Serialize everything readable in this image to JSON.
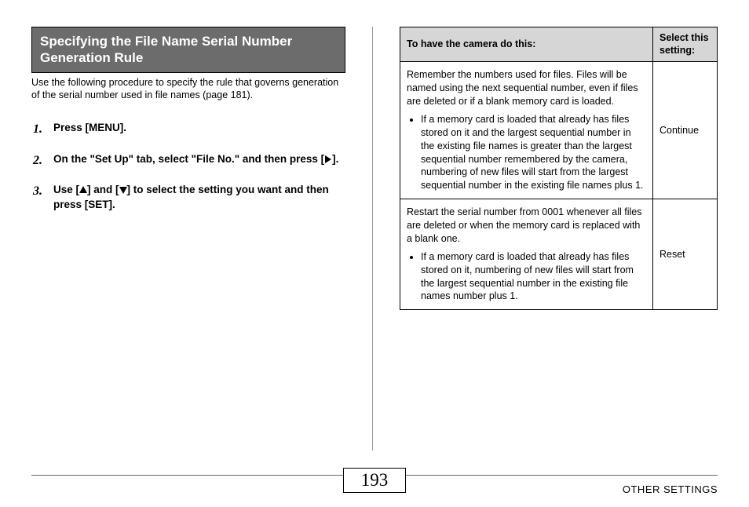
{
  "header": {
    "title": "Specifying the File Name Serial Number Generation Rule"
  },
  "intro": "Use the following procedure to specify the rule that governs generation of the serial number used in file names (page 181).",
  "steps": [
    {
      "num": "1.",
      "text": "Press [MENU]."
    },
    {
      "num": "2.",
      "text_before": "On the \"Set Up\" tab, select \"File No.\" and then press [",
      "text_after": "]."
    },
    {
      "num": "3.",
      "text_before": "Use [",
      "text_mid": "] and [",
      "text_after": "] to select the setting you want and then press [SET]."
    }
  ],
  "table": {
    "header_col1": "To have the camera do this:",
    "header_col2": "Select this setting:",
    "rows": [
      {
        "desc_para": "Remember the numbers used for files. Files will be named using the next sequential number, even if files are deleted or if a blank memory card is loaded.",
        "bullet": "If a memory card is loaded that already has files stored on it and the largest sequential number in the existing file names is greater than the largest sequential number remembered by the camera, numbering of new files will start from the largest sequential number in the existing file names plus 1.",
        "setting": "Continue"
      },
      {
        "desc_para": "Restart the serial number from 0001 whenever all files are deleted or when the memory card is replaced with a blank one.",
        "bullet": "If a memory card is loaded that already has files stored on it, numbering of new files will start from the largest sequential number in the existing file names number plus 1.",
        "setting": "Reset"
      }
    ]
  },
  "footer": {
    "page_number": "193",
    "section_label": "OTHER SETTINGS"
  }
}
